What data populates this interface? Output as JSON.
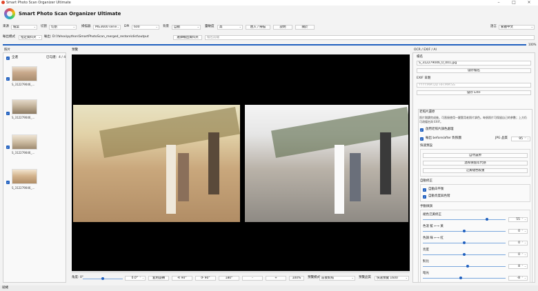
{
  "window": {
    "title": "Smart Photo Scan Organizer Ultimate"
  },
  "app": {
    "title": "Smart Photo Scan Organizer Ultimate"
  },
  "toolbar": {
    "source_label": "來源",
    "source_value": "檔案",
    "crop_label": "切割",
    "crop_value": "切割",
    "scanner_label": "掃描器",
    "scanner_value": "MG3600 serie",
    "dpi_label": "DPI",
    "dpi_value": "600",
    "bg_label": "背景",
    "bg_value": "自動",
    "sensitivity_label": "靈敏度",
    "sensitivity_value": "高",
    "import_label": "匯入 / 掃描",
    "help_label": "說明",
    "about_label": "關於",
    "language_label": "語言",
    "language_value": "繁體中文"
  },
  "output": {
    "mode_label": "輸出模式",
    "mode_value": "指定資料夾",
    "path_label": "輸出: D:\\Yahoo\\python\\SmartPhotoScan_merged_restore\\dist\\output",
    "choose_label": "選擇輸出資料夾",
    "prefix_placeholder": "檔名前綴",
    "progress_percent": 100,
    "progress_text": "100%"
  },
  "photos": {
    "panel_label": "照片",
    "select_all": "全選",
    "selected_count": "已勾選：4 / 4",
    "items": [
      {
        "name": "S_312279046_..."
      },
      {
        "name": "S_312279046_..."
      },
      {
        "name": "S_312279046_..."
      },
      {
        "name": "S_312279046_..."
      }
    ]
  },
  "preview": {
    "panel_label": "預覽",
    "angle_label": "角度: 0°",
    "angle_value": "0.0°",
    "apply_rotate": "套用旋轉",
    "rot_ccw": "⟲ 90°",
    "rot_cw": "⟳ 90°",
    "rot_180": "180°",
    "zoom_out": "-",
    "zoom_in": "+",
    "zoom_value": "100%",
    "preview_mode_label": "預覽模式",
    "preview_mode_value": "前後對照",
    "preview_quality_label": "預覽品質",
    "preview_quality_value": "快速預覽 1600"
  },
  "right": {
    "panel_label": "OCR / EXIF / AI",
    "filename_label": "檔名",
    "filename_value": "S_312279046_0_001.jpg",
    "save_name": "儲存檔名",
    "exif_date_label": "EXIF 日期",
    "exif_placeholder": "YYYY:MM:DD HH:MM:SS",
    "save_exif": "儲存 EXIF",
    "restore": {
      "title": "老照片還原",
      "desc": "照片剛讀完成後，可直接使用一鍵套用老照片調色。每張照片可保留自己的參數；上方仍可改檔名與 EXIF。",
      "enable": "啟用老照片調色處理",
      "compare": "輸出 before/after 對照圖",
      "jpg_label": "JPG 品質",
      "jpg_value": "95"
    },
    "presets": {
      "title": "快速預設",
      "auto": "自然還原",
      "warm": "溫和保留年代感",
      "strong": "泛黃褪色較重"
    },
    "auto_fix": {
      "title": "自動修正",
      "white_balance": "自動白平衡",
      "exposure": "自動亮度與色階"
    },
    "manual": {
      "title": "手動微調",
      "sliders": [
        {
          "label": "褪色泛黃修正",
          "value": 55,
          "display": "55"
        },
        {
          "label": "色溫  藍 ←→ 黃",
          "value": 0,
          "display": "0"
        },
        {
          "label": "色調  綠 ←→ 紅",
          "value": 0,
          "display": "0"
        },
        {
          "label": "亮度",
          "value": 0,
          "display": "0"
        },
        {
          "label": "對比",
          "value": 8,
          "display": "8"
        },
        {
          "label": "暗光",
          "value": -8,
          "display": "-8"
        }
      ]
    }
  },
  "status": {
    "text": "就緒"
  },
  "colors": {
    "accent": "#1f5fbf",
    "black_canvas": "#000000"
  }
}
